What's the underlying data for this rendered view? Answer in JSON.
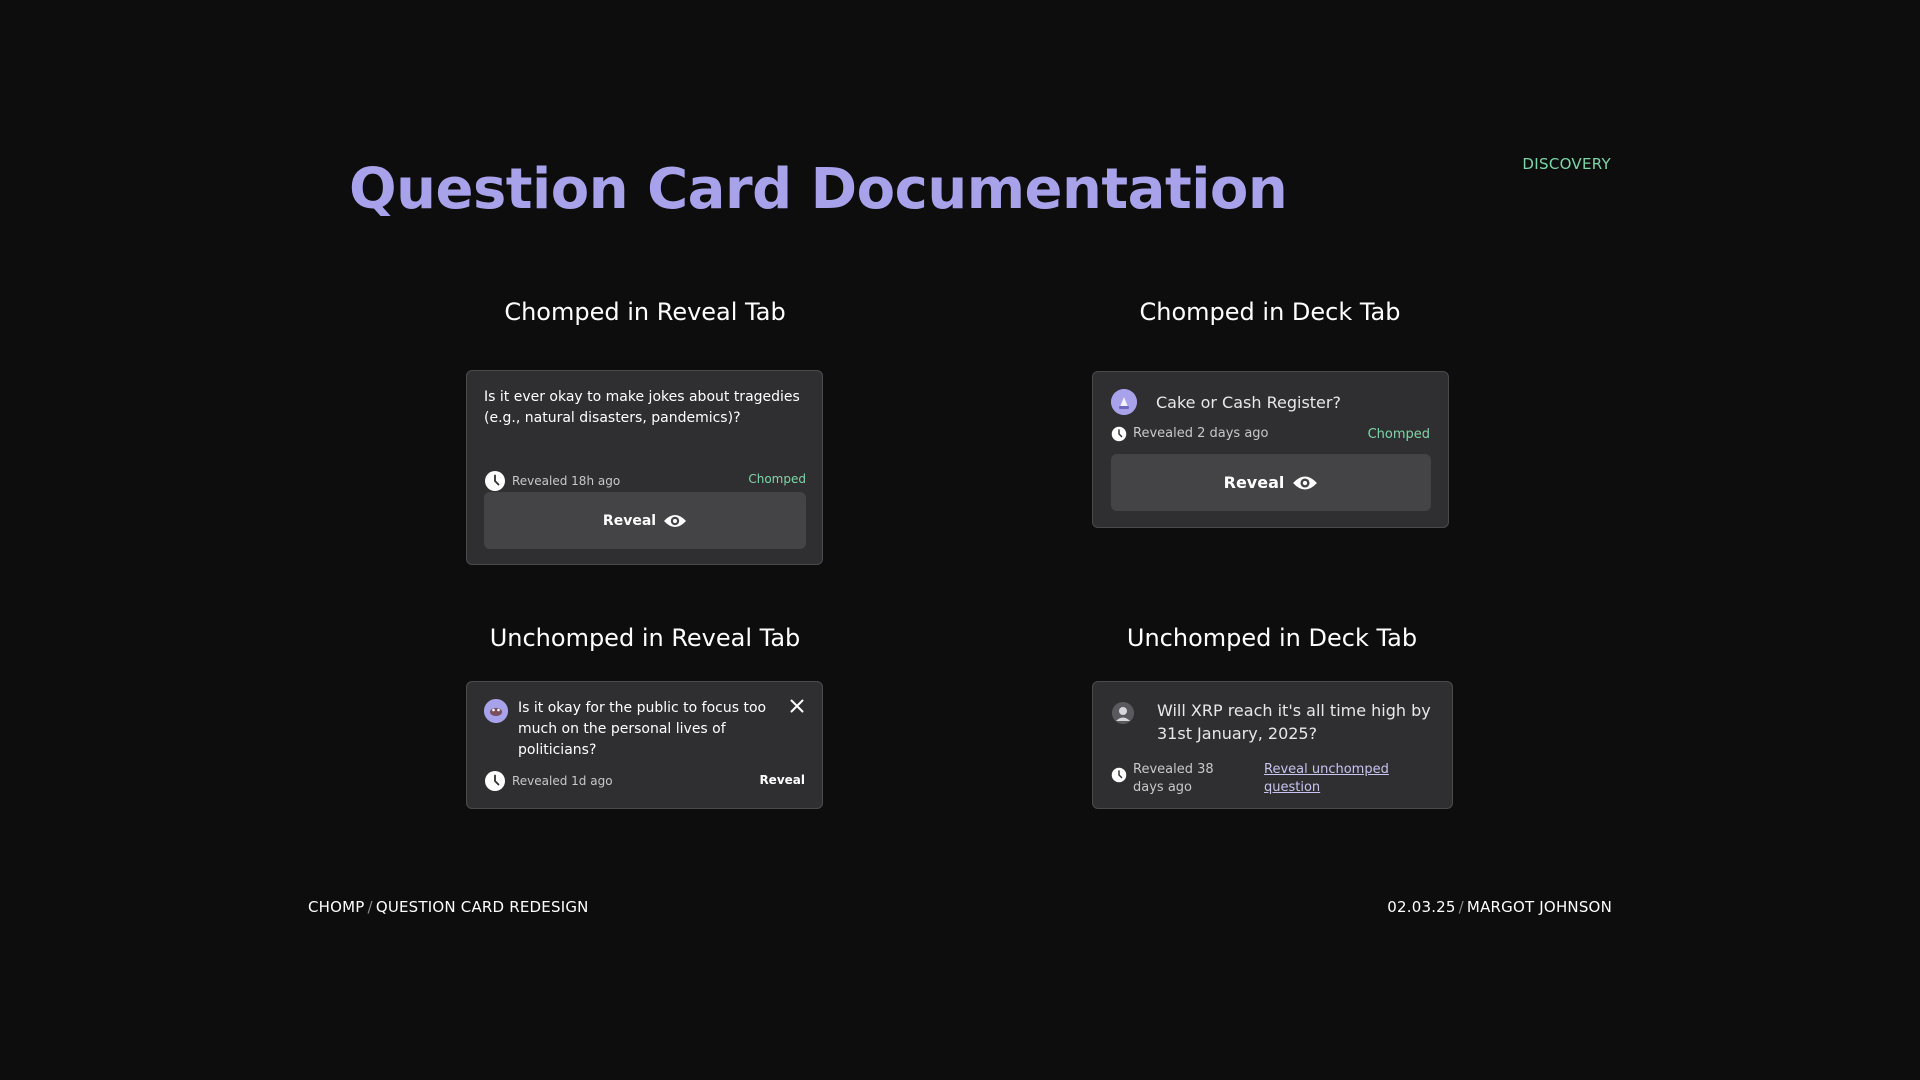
{
  "header": {
    "title": "Question Card Documentation",
    "section_tag": "DISCOVERY"
  },
  "sections": {
    "chomped_reveal": {
      "heading": "Chomped in Reveal Tab",
      "question": "Is it ever okay to make jokes about tragedies (e.g., natural disasters, pandemics)?",
      "revealed": "Revealed 18h ago",
      "status": "Chomped",
      "button_label": "Reveal"
    },
    "chomped_deck": {
      "heading": "Chomped in Deck Tab",
      "question": "Cake or Cash Register?",
      "revealed": "Revealed 2 days ago",
      "status": "Chomped",
      "button_label": "Reveal"
    },
    "unchomped_reveal": {
      "heading": "Unchomped in Reveal Tab",
      "question": "Is it okay for the public to focus too much on the personal lives of politicians?",
      "revealed": "Revealed 1d ago",
      "action_label": "Reveal"
    },
    "unchomped_deck": {
      "heading": "Unchomped in Deck Tab",
      "question": "Will XRP reach it's all time high by 31st January, 2025?",
      "revealed": "Revealed 38 days ago",
      "link_label": "Reveal unchomped question"
    }
  },
  "footer": {
    "left_primary": "CHOMP",
    "left_separator": "/",
    "left_secondary": "QUESTION CARD REDESIGN",
    "right_primary": "02.03.25",
    "right_separator": "/",
    "right_secondary": "MARGOT JOHNSON"
  },
  "colors": {
    "background": "#0d0d0d",
    "title": "#a8a2eb",
    "accent_green": "#7ed6a8",
    "card": "#2f2f31",
    "button": "#444446",
    "link": "#c9c4f0"
  },
  "icons": {
    "clock": "clock-icon",
    "eye": "eye-icon",
    "close": "close-icon",
    "avatar": "avatar"
  }
}
